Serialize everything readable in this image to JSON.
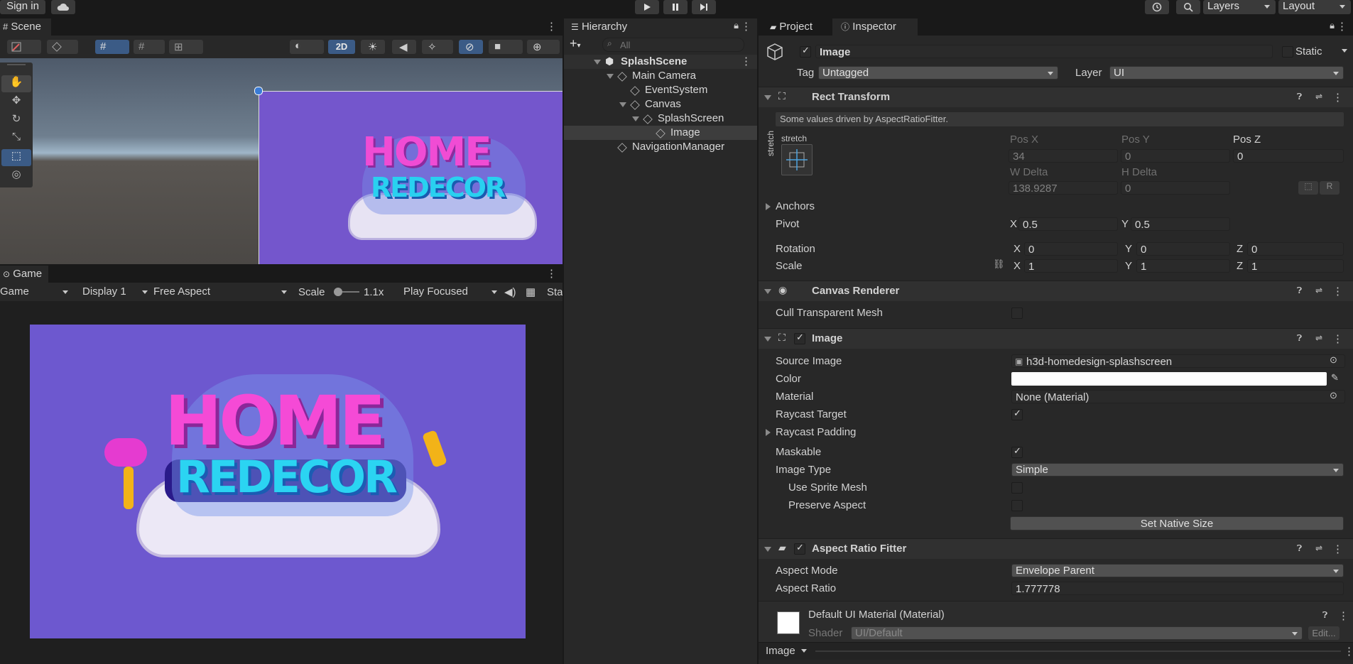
{
  "toolbar": {
    "signin": "Sign in",
    "layers": "Layers",
    "layout": "Layout"
  },
  "scene": {
    "tab": "Scene",
    "mode_2d": "2D"
  },
  "game": {
    "tab": "Game",
    "dropdown_game": "Game",
    "display": "Display 1",
    "aspect": "Free Aspect",
    "scale_label": "Scale",
    "scale_value": "1.1x",
    "play_focused": "Play Focused",
    "stats_partial": "Sta"
  },
  "logo": {
    "line1": "HOME",
    "line2": "REDECOR"
  },
  "hierarchy": {
    "tab": "Hierarchy",
    "search_placeholder": "All",
    "items": [
      {
        "label": "SplashScene"
      },
      {
        "label": "Main Camera"
      },
      {
        "label": "EventSystem"
      },
      {
        "label": "Canvas"
      },
      {
        "label": "SplashScreen"
      },
      {
        "label": "Image"
      },
      {
        "label": "NavigationManager"
      }
    ]
  },
  "inspector": {
    "tab_project": "Project",
    "tab_inspector": "Inspector",
    "object_name": "Image",
    "static": "Static",
    "tag_label": "Tag",
    "tag_value": "Untagged",
    "layer_label": "Layer",
    "layer_value": "UI",
    "rect": {
      "title": "Rect Transform",
      "info": "Some values driven by AspectRatioFitter.",
      "anchor_h": "stretch",
      "anchor_v": "stretch",
      "posx_label": "Pos X",
      "posx": "34",
      "posy_label": "Pos Y",
      "posy": "0",
      "posz_label": "Pos Z",
      "posz": "0",
      "wdelta_label": "W Delta",
      "wdelta": "138.9287",
      "hdelta_label": "H Delta",
      "hdelta": "0",
      "anchors": "Anchors",
      "pivot": "Pivot",
      "pivot_x": "0.5",
      "pivot_y": "0.5",
      "rotation": "Rotation",
      "rot_x": "0",
      "rot_y": "0",
      "rot_z": "0",
      "scale": "Scale",
      "scale_x": "1",
      "scale_y": "1",
      "scale_z": "1",
      "x": "X",
      "y": "Y",
      "z": "Z"
    },
    "canvas_renderer": {
      "title": "Canvas Renderer",
      "cull": "Cull Transparent Mesh"
    },
    "image": {
      "title": "Image",
      "source_label": "Source Image",
      "source_value": "h3d-homedesign-splashscreen",
      "color_label": "Color",
      "material_label": "Material",
      "material_value": "None (Material)",
      "raycast_target": "Raycast Target",
      "raycast_padding": "Raycast Padding",
      "maskable": "Maskable",
      "image_type_label": "Image Type",
      "image_type_value": "Simple",
      "use_sprite_mesh": "Use Sprite Mesh",
      "preserve_aspect": "Preserve Aspect",
      "set_native": "Set Native Size"
    },
    "aspect_fitter": {
      "title": "Aspect Ratio Fitter",
      "mode_label": "Aspect Mode",
      "mode_value": "Envelope Parent",
      "ratio_label": "Aspect Ratio",
      "ratio_value": "1.777778"
    },
    "material": {
      "title": "Default UI Material (Material)",
      "shader_label": "Shader",
      "shader_value": "UI/Default",
      "edit": "Edit..."
    },
    "footer": "Image"
  },
  "colors": {
    "game_bg": "#6d58cf",
    "scene_canvas": "#7456cc",
    "accent_blue": "#2c5d87"
  }
}
